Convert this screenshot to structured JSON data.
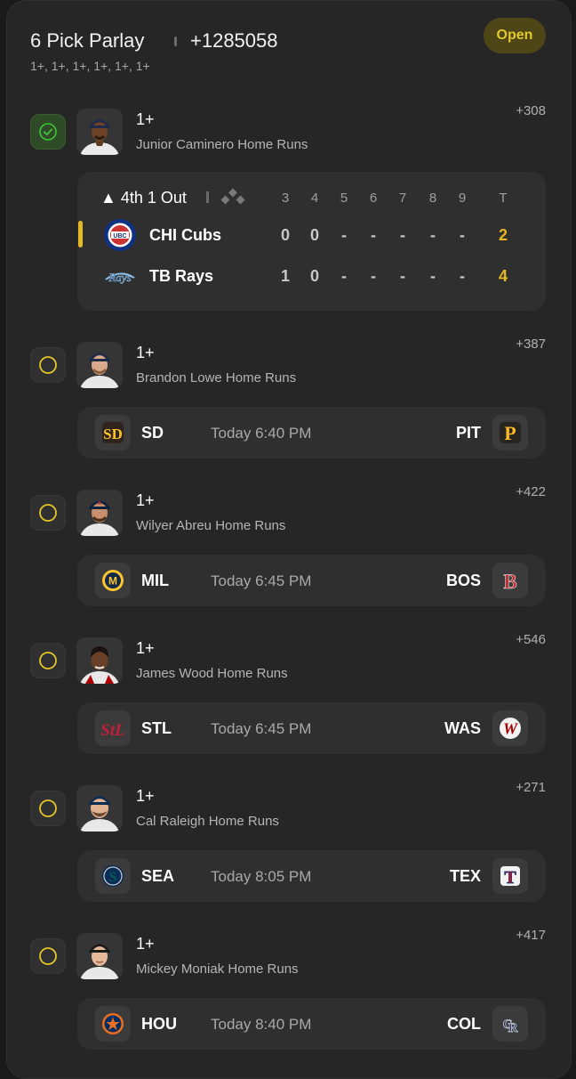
{
  "header": {
    "title": "6 Pick Parlay",
    "odds": "+1285058",
    "subtitle": "1+, 1+, 1+, 1+, 1+, 1+",
    "status_badge": "Open"
  },
  "colors": {
    "accent_yellow": "#e5b826",
    "badge_bg": "#4e4616",
    "won_green": "#3ec43a",
    "card_bg": "#262626"
  },
  "legs": [
    {
      "status": "won",
      "line": "1+",
      "market": "Junior Caminero Home Runs",
      "odds": "+308",
      "live": {
        "inning": "4th 1 Out",
        "columns": [
          "3",
          "4",
          "5",
          "6",
          "7",
          "8",
          "9",
          "T"
        ],
        "teams": [
          {
            "name": "CHI Cubs",
            "logo": "cubs-logo",
            "cells": [
              "0",
              "0",
              "-",
              "-",
              "-",
              "-",
              "-",
              "2"
            ]
          },
          {
            "name": "TB Rays",
            "logo": "rays-logo",
            "cells": [
              "1",
              "0",
              "-",
              "-",
              "-",
              "-",
              "-",
              "4"
            ]
          }
        ]
      }
    },
    {
      "status": "open",
      "line": "1+",
      "market": "Brandon Lowe Home Runs",
      "odds": "+387",
      "game": {
        "away": "SD",
        "home": "PIT",
        "time": "Today 6:40 PM",
        "away_logo": "padres-logo",
        "home_logo": "pirates-logo"
      }
    },
    {
      "status": "open",
      "line": "1+",
      "market": "Wilyer Abreu Home Runs",
      "odds": "+422",
      "game": {
        "away": "MIL",
        "home": "BOS",
        "time": "Today 6:45 PM",
        "away_logo": "brewers-logo",
        "home_logo": "red-sox-logo"
      }
    },
    {
      "status": "open",
      "line": "1+",
      "market": "James Wood Home Runs",
      "odds": "+546",
      "game": {
        "away": "STL",
        "home": "WAS",
        "time": "Today 6:45 PM",
        "away_logo": "cardinals-logo",
        "home_logo": "nationals-logo"
      }
    },
    {
      "status": "open",
      "line": "1+",
      "market": "Cal Raleigh Home Runs",
      "odds": "+271",
      "game": {
        "away": "SEA",
        "home": "TEX",
        "time": "Today 8:05 PM",
        "away_logo": "mariners-logo",
        "home_logo": "rangers-logo"
      }
    },
    {
      "status": "open",
      "line": "1+",
      "market": "Mickey Moniak Home Runs",
      "odds": "+417",
      "game": {
        "away": "HOU",
        "home": "COL",
        "time": "Today 8:40 PM",
        "away_logo": "astros-logo",
        "home_logo": "rockies-logo"
      }
    }
  ]
}
